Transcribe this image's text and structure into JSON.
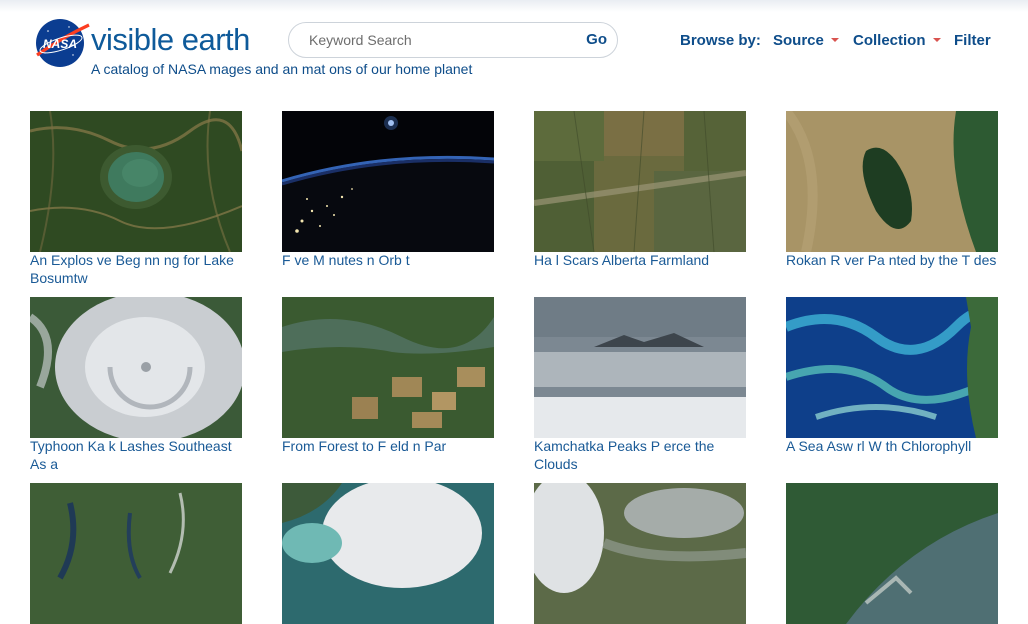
{
  "brand": {
    "name": "visible earth",
    "logo_text": "NASA",
    "tagline": "A catalog of NASA  mages and an mat ons of our home planet"
  },
  "search": {
    "placeholder": "Keyword Search",
    "go_label": "Go"
  },
  "nav": {
    "browse_label": "Browse by:",
    "source_label": "Source",
    "collection_label": "Collection",
    "filter_label": "Filter"
  },
  "colors": {
    "link": "#0e4d8a",
    "accent_caret": "#d9534f"
  },
  "gallery": [
    {
      "caption": "An Explos ve Beg nn ng for Lake Bosumtw",
      "scene": "lake-crater"
    },
    {
      "caption": "F ve M nutes  n Orb t",
      "scene": "night-orbit"
    },
    {
      "caption": "Ha l Scars Alberta Farmland",
      "scene": "farmland"
    },
    {
      "caption": "Rokan R ver Pa nted by the T des",
      "scene": "river-tides"
    },
    {
      "caption": "Typhoon Ka  k  Lashes Southeast As a",
      "scene": "typhoon"
    },
    {
      "caption": "From Forest to F eld  n Par",
      "scene": "forest-field"
    },
    {
      "caption": "Kamchatka Peaks P erce the Clouds",
      "scene": "kamchatka"
    },
    {
      "caption": "A Sea Asw rl W th Chlorophyll",
      "scene": "chlorophyll"
    },
    {
      "caption": "",
      "scene": "mountain-lakes"
    },
    {
      "caption": "",
      "scene": "hurricane"
    },
    {
      "caption": "",
      "scene": "smoke"
    },
    {
      "caption": "",
      "scene": "coast"
    }
  ]
}
